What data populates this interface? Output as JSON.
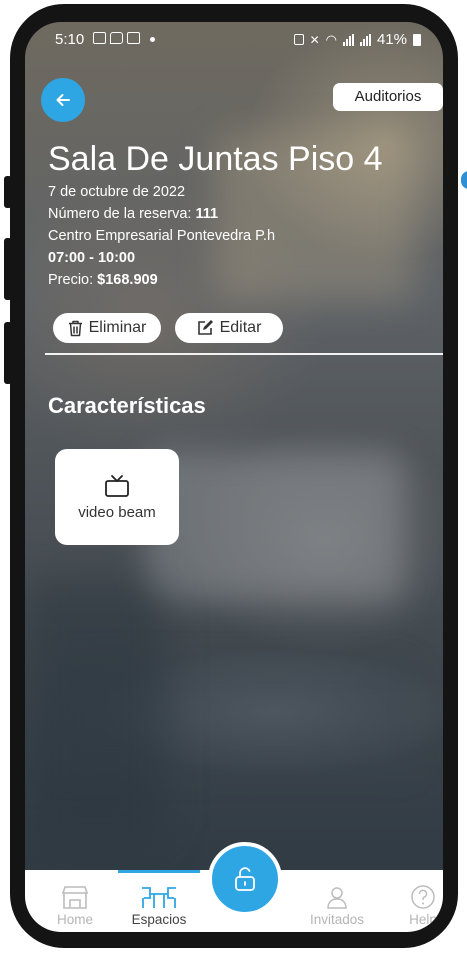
{
  "status_bar": {
    "time": "5:10",
    "battery": "41%"
  },
  "header": {
    "auditorios_label": "Auditorios"
  },
  "booking": {
    "title": "Sala De Juntas Piso 4",
    "date": "7 de octubre de 2022",
    "reservation_label": "Número de la reserva: ",
    "reservation_number": "111",
    "location": "Centro Empresarial Pontevedra P.h",
    "time_range": "07:00 - 10:00",
    "price_label": "Precio: ",
    "price_value": "$168.909"
  },
  "actions": {
    "delete_label": "Eliminar",
    "edit_label": "Editar"
  },
  "features": {
    "title": "Características",
    "items": [
      {
        "label": "video beam",
        "icon": "tv-icon"
      }
    ]
  },
  "bottom_nav": {
    "items": [
      {
        "label": "Home",
        "icon": "store-icon",
        "active": false
      },
      {
        "label": "Espacios",
        "icon": "workspace-icon",
        "active": true
      },
      {
        "label": "Invitados",
        "icon": "person-icon",
        "active": false
      },
      {
        "label": "Help",
        "icon": "help-icon",
        "active": false
      }
    ],
    "fab_icon": "unlock-icon"
  },
  "colors": {
    "accent": "#2fa6e4",
    "frame": "#141414",
    "surface": "#ffffff",
    "inactive_nav": "#b5b5b5"
  }
}
